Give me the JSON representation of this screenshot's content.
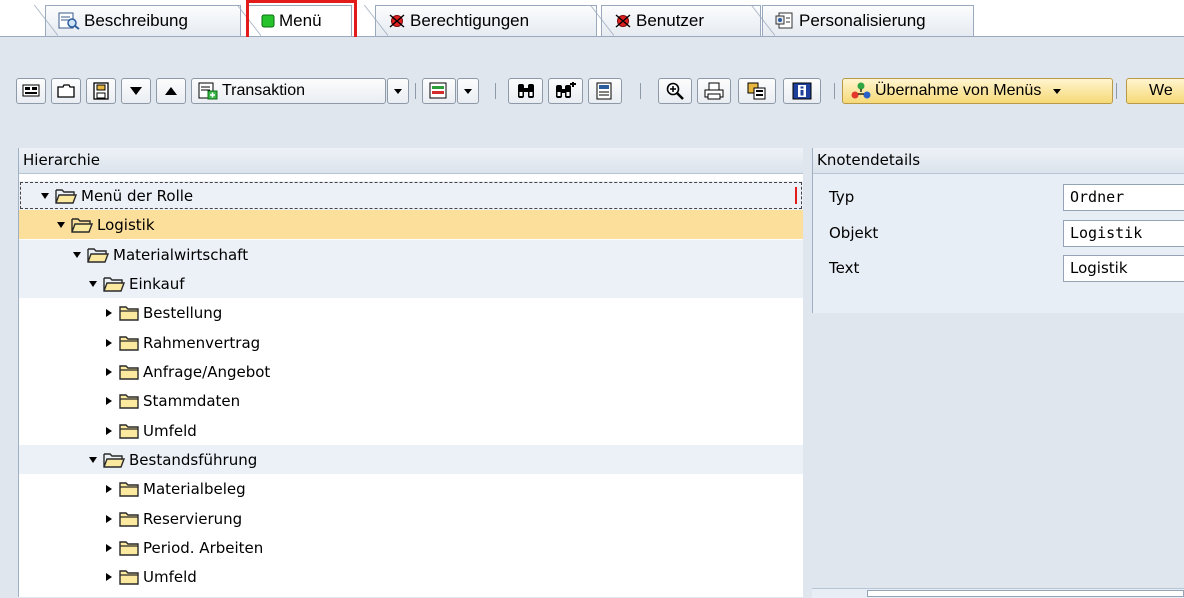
{
  "tabs": [
    {
      "label": "Beschreibung",
      "icon": "description-icon"
    },
    {
      "label": "Menü",
      "icon": "menu-green-square-icon",
      "active": true
    },
    {
      "label": "Berechtigungen",
      "icon": "auth-status-red-icon"
    },
    {
      "label": "Benutzer",
      "icon": "user-status-red-icon"
    },
    {
      "label": "Personalisierung",
      "icon": "personalization-icon"
    }
  ],
  "toolbar": {
    "transaction_label": "Transaktion",
    "take_over_menus_label": "Übernahme von Menüs",
    "more_label": "We"
  },
  "hierarchy": {
    "header": "Hierarchie",
    "nodes": [
      {
        "label": "Menü der Rolle",
        "level": 0,
        "state": "expanded"
      },
      {
        "label": "Logistik",
        "level": 1,
        "state": "expanded"
      },
      {
        "label": "Materialwirtschaft",
        "level": 2,
        "state": "expanded"
      },
      {
        "label": "Einkauf",
        "level": 3,
        "state": "expanded"
      },
      {
        "label": "Bestellung",
        "level": 4,
        "state": "collapsed"
      },
      {
        "label": "Rahmenvertrag",
        "level": 4,
        "state": "collapsed"
      },
      {
        "label": "Anfrage/Angebot",
        "level": 4,
        "state": "collapsed"
      },
      {
        "label": "Stammdaten",
        "level": 4,
        "state": "collapsed"
      },
      {
        "label": "Umfeld",
        "level": 4,
        "state": "collapsed"
      },
      {
        "label": "Bestandsführung",
        "level": 3,
        "state": "expanded"
      },
      {
        "label": "Materialbeleg",
        "level": 4,
        "state": "collapsed"
      },
      {
        "label": "Reservierung",
        "level": 4,
        "state": "collapsed"
      },
      {
        "label": "Period. Arbeiten",
        "level": 4,
        "state": "collapsed"
      },
      {
        "label": "Umfeld",
        "level": 4,
        "state": "collapsed"
      }
    ]
  },
  "details": {
    "header": "Knotendetails",
    "fields": [
      {
        "label": "Typ",
        "value": "Ordner"
      },
      {
        "label": "Objekt",
        "value": "Logistik"
      },
      {
        "label": "Text",
        "value": "Logistik"
      }
    ]
  },
  "colors": {
    "highlight": "#e21b1b",
    "selection": "#fbdf9a",
    "folder_fill": "#fbe9a0",
    "folder_stroke": "#2a2a2a"
  }
}
